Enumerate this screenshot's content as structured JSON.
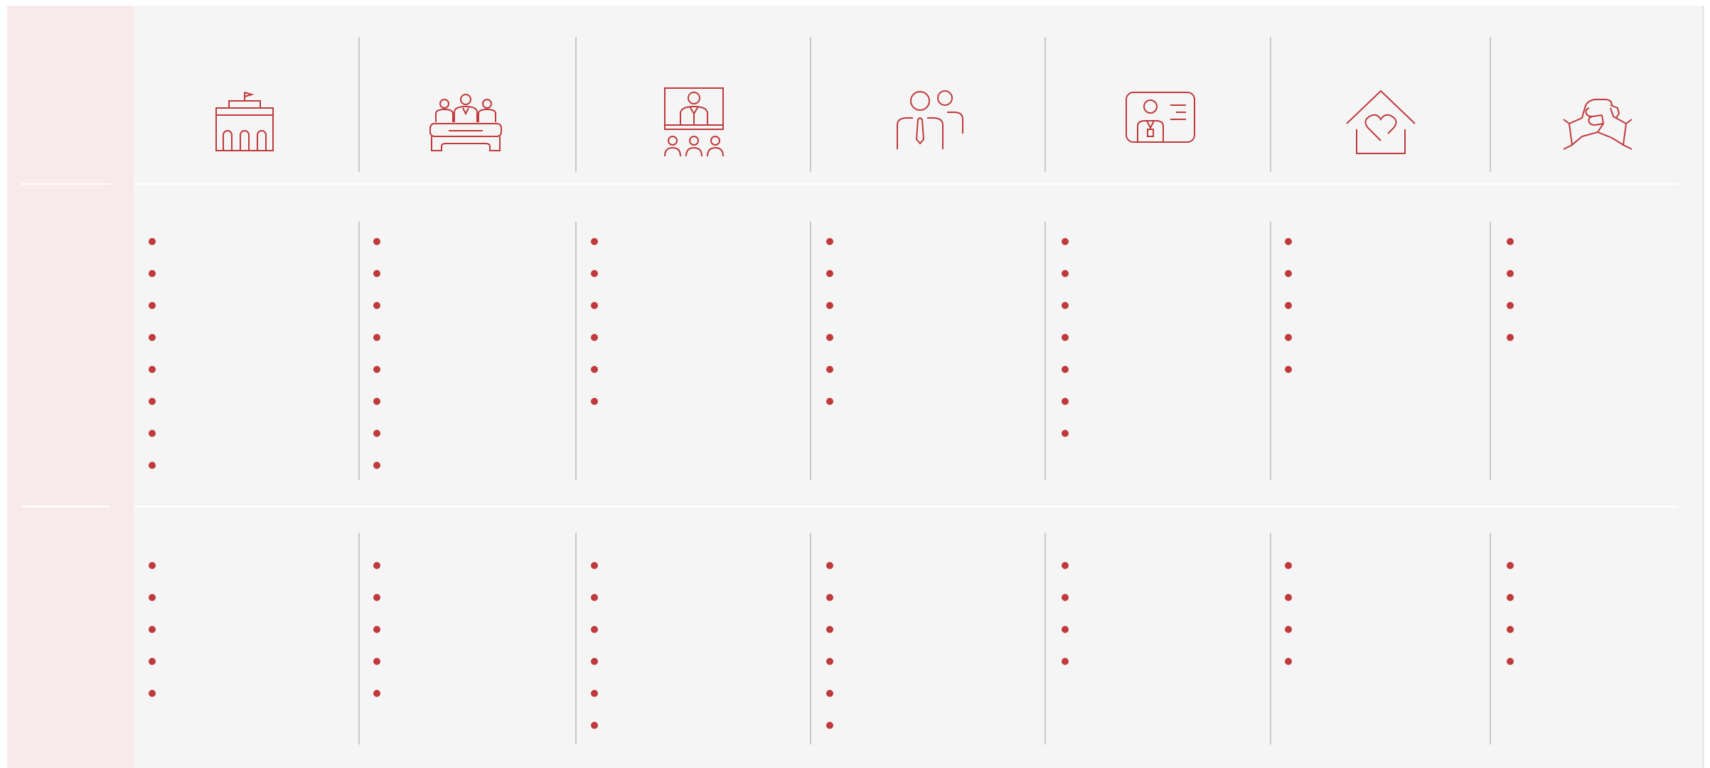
{
  "colors": {
    "accent": "#c0393b",
    "divider": "#c9c9c9",
    "panel": "#f5f5f5",
    "sidebar": "#f8eaea"
  },
  "columns": [
    {
      "icon": "government-building-icon",
      "row1_items": 8,
      "row2_items": 5
    },
    {
      "icon": "panel-meeting-icon",
      "row1_items": 8,
      "row2_items": 5
    },
    {
      "icon": "presentation-screen-icon",
      "row1_items": 6,
      "row2_items": 6
    },
    {
      "icon": "people-pair-icon",
      "row1_items": 6,
      "row2_items": 6
    },
    {
      "icon": "id-card-icon",
      "row1_items": 7,
      "row2_items": 4
    },
    {
      "icon": "home-heart-icon",
      "row1_items": 5,
      "row2_items": 4
    },
    {
      "icon": "handshake-icon",
      "row1_items": 4,
      "row2_items": 4
    }
  ]
}
